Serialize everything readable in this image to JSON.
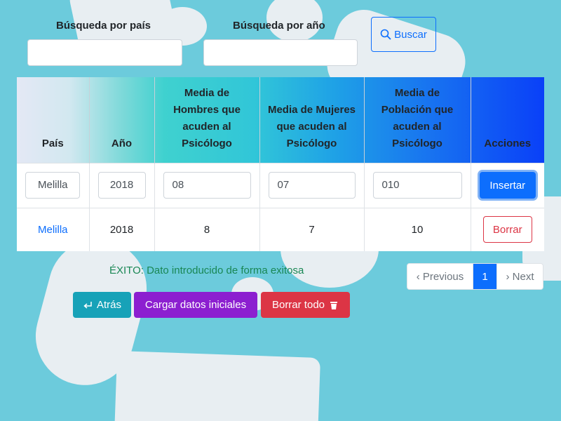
{
  "search": {
    "country_label": "Búsqueda por país",
    "year_label": "Búsqueda por año",
    "button_label": "Buscar"
  },
  "table": {
    "headers": [
      "País",
      "Año",
      "Media de Hombres que acuden al Psicólogo",
      "Media de Mujeres que acuden al Psicólogo",
      "Media de Población que acuden al Psicólogo",
      "Acciones"
    ],
    "input_row": {
      "country": "Melilla",
      "year": "2018",
      "men": "08",
      "women": "07",
      "population": "010",
      "insert_label": "Insertar"
    },
    "rows": [
      {
        "country": "Melilla",
        "year": "2018",
        "men": "8",
        "women": "7",
        "population": "10",
        "delete_label": "Borrar"
      }
    ]
  },
  "status": {
    "message": "ÉXITO: Dato introducido de forma exitosa"
  },
  "pagination": {
    "previous": "‹ Previous",
    "current": "1",
    "next": "› Next"
  },
  "actions": {
    "back_label": "Atrás",
    "load_label": "Cargar datos iniciales",
    "clear_label": "Borrar todo"
  },
  "colors": {
    "primary": "#0d6efd",
    "danger": "#dc3545",
    "info": "#17a2b8",
    "purple": "#8c1fd0",
    "success": "#198754",
    "background": "#6ccbdc"
  },
  "icons": {
    "search": "search-icon",
    "back": "return-arrow-icon",
    "clear": "trash-icon"
  }
}
